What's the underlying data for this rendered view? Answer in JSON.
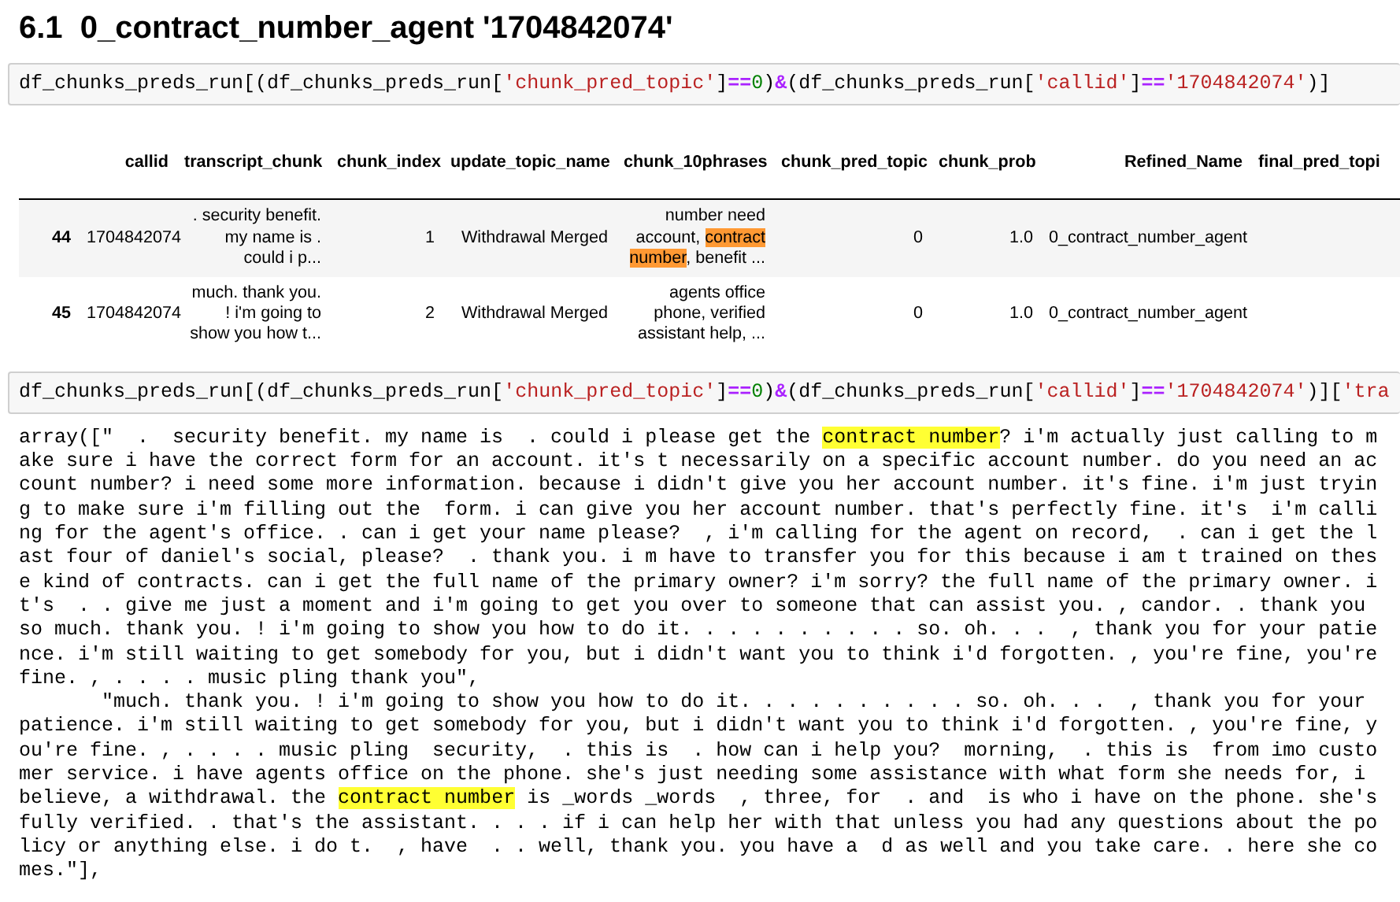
{
  "heading": "6.1  0_contract_number_agent '1704842074'",
  "cells": [
    {
      "kind": "code",
      "segments": [
        {
          "text": "df_chunks_preds_run[(df_chunks_preds_run[",
          "kind": "plain"
        },
        {
          "text": "'chunk_pred_topic'",
          "kind": "string"
        },
        {
          "text": "]",
          "kind": "plain"
        },
        {
          "text": "==",
          "kind": "operator"
        },
        {
          "text": "0",
          "kind": "number"
        },
        {
          "text": ")",
          "kind": "plain"
        },
        {
          "text": "&",
          "kind": "operator"
        },
        {
          "text": "(df_chunks_preds_run[",
          "kind": "plain"
        },
        {
          "text": "'callid'",
          "kind": "string"
        },
        {
          "text": "]",
          "kind": "plain"
        },
        {
          "text": "==",
          "kind": "operator"
        },
        {
          "text": "'1704842074'",
          "kind": "string"
        },
        {
          "text": ")]",
          "kind": "plain"
        }
      ]
    },
    {
      "kind": "table",
      "columns": [
        "",
        "callid",
        "transcript_chunk",
        "chunk_index",
        "update_topic_name",
        "chunk_10phrases",
        "chunk_pred_topic",
        "chunk_prob",
        "Refined_Name",
        "final_pred_topi"
      ],
      "rows": [
        {
          "cells": [
            "44",
            "1704842074",
            ". security benefit. my name is . could i p...",
            "1",
            "Withdrawal Merged",
            [
              {
                "text": "number need account, ",
                "highlighted": false
              },
              {
                "text": "contract number",
                "highlighted": true
              },
              {
                "text": ", benefit ...",
                "highlighted": false
              }
            ],
            "0",
            "1.0",
            "0_contract_number_agent"
          ]
        },
        {
          "cells": [
            "45",
            "1704842074",
            "much. thank you. ! i'm going to show you how t...",
            "2",
            "Withdrawal Merged",
            "agents office phone, verified assistant help, ...",
            "0",
            "1.0",
            "0_contract_number_agent"
          ]
        }
      ]
    },
    {
      "kind": "code",
      "segments": [
        {
          "text": "df_chunks_preds_run[(df_chunks_preds_run[",
          "kind": "plain"
        },
        {
          "text": "'chunk_pred_topic'",
          "kind": "string"
        },
        {
          "text": "]",
          "kind": "plain"
        },
        {
          "text": "==",
          "kind": "operator"
        },
        {
          "text": "0",
          "kind": "number"
        },
        {
          "text": ")",
          "kind": "plain"
        },
        {
          "text": "&",
          "kind": "operator"
        },
        {
          "text": "(df_chunks_preds_run[",
          "kind": "plain"
        },
        {
          "text": "'callid'",
          "kind": "string"
        },
        {
          "text": "]",
          "kind": "plain"
        },
        {
          "text": "==",
          "kind": "operator"
        },
        {
          "text": "'1704842074'",
          "kind": "string"
        },
        {
          "text": ")][",
          "kind": "plain"
        },
        {
          "text": "'tra",
          "kind": "string"
        }
      ]
    },
    {
      "kind": "output",
      "lines": [
        [
          {
            "text": "array([\"  .  security benefit. my name is  . could i please get the ",
            "highlighted": false
          },
          {
            "text": "contract number",
            "highlighted": true
          },
          {
            "text": "? i'm actually just calling to m",
            "highlighted": false
          }
        ],
        [
          {
            "text": "ake sure i have the correct form for an account. it's t necessarily on a specific account number. do you need an ac",
            "highlighted": false
          }
        ],
        [
          {
            "text": "count number? i need some more information. because i didn't give you her account number. it's fine. i'm just tryin",
            "highlighted": false
          }
        ],
        [
          {
            "text": "g to make sure i'm filling out the  form. i can give you her account number. that's perfectly fine. it's  i'm calli",
            "highlighted": false
          }
        ],
        [
          {
            "text": "ng for the agent's office. . can i get your name please?  , i'm calling for the agent on record,  . can i get the l",
            "highlighted": false
          }
        ],
        [
          {
            "text": "ast four of daniel's social, please?  . thank you. i m have to transfer you for this because i am t trained on thes",
            "highlighted": false
          }
        ],
        [
          {
            "text": "e kind of contracts. can i get the full name of the primary owner? i'm sorry? the full name of the primary owner. i",
            "highlighted": false
          }
        ],
        [
          {
            "text": "t's  . . give me just a moment and i'm going to get you over to someone that can assist you. , candor. . thank you",
            "highlighted": false
          }
        ],
        [
          {
            "text": "so much. thank you. ! i'm going to show you how to do it. . . . . . . . . . so. oh. . .  , thank you for your patie",
            "highlighted": false
          }
        ],
        [
          {
            "text": "nce. i'm still waiting to get somebody for you, but i didn't want you to think i'd forgotten. , you're fine, you're",
            "highlighted": false
          }
        ],
        [
          {
            "text": "fine. , . . . . music pling thank you\",",
            "highlighted": false
          }
        ],
        [
          {
            "text": "       \"much. thank you. ! i'm going to show you how to do it. . . . . . . . . . so. oh. . .  , thank you for your",
            "highlighted": false
          }
        ],
        [
          {
            "text": "patience. i'm still waiting to get somebody for you, but i didn't want you to think i'd forgotten. , you're fine, y",
            "highlighted": false
          }
        ],
        [
          {
            "text": "ou're fine. , . . . . music pling  security,  . this is  . how can i help you?  morning,  . this is  from imo custo",
            "highlighted": false
          }
        ],
        [
          {
            "text": "mer service. i have agents office on the phone. she's just needing some assistance with what form she needs for, i",
            "highlighted": false
          }
        ],
        [
          {
            "text": "believe, a withdrawal. the ",
            "highlighted": false
          },
          {
            "text": "contract number",
            "highlighted": true
          },
          {
            "text": " is _words _words  , three, for  . and  is who i have on the phone. she's",
            "highlighted": false
          }
        ],
        [
          {
            "text": "fully verified. . that's the assistant. . . . if i can help her with that unless you had any questions about the po",
            "highlighted": false
          }
        ],
        [
          {
            "text": "licy or anything else. i do t.  , have  . . well, thank you. you have a  d as well and you take care. . here she co",
            "highlighted": false
          }
        ],
        [
          {
            "text": "mes.\"],",
            "highlighted": false
          }
        ]
      ]
    }
  ]
}
